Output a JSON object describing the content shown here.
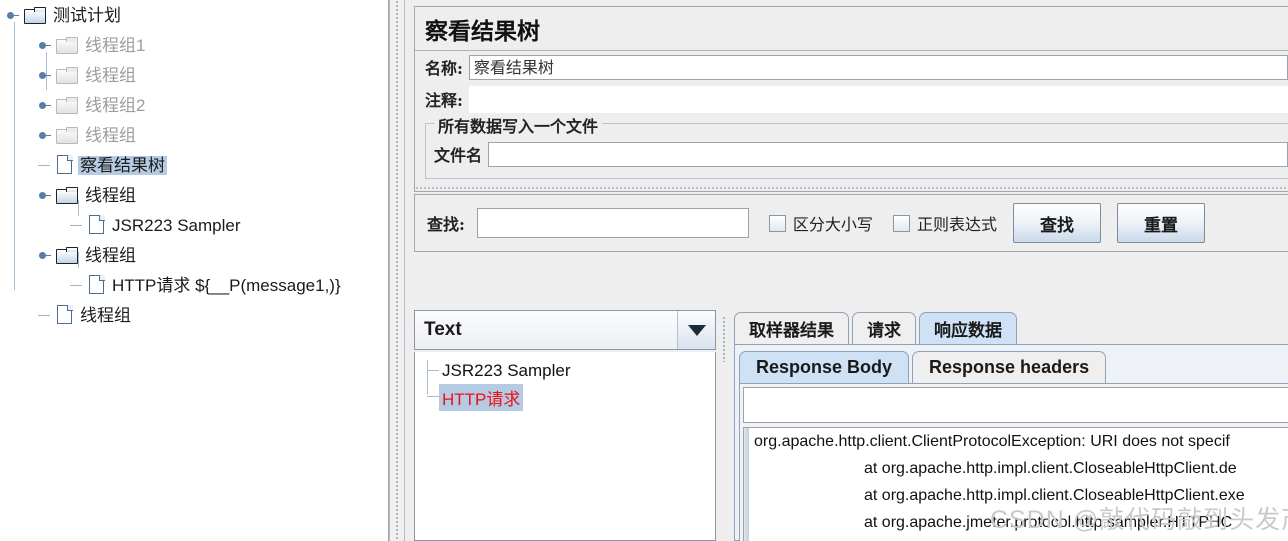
{
  "tree": {
    "items": [
      {
        "label": "测试计划",
        "depth": 0,
        "icon": "folder-icon",
        "handle": "expand-knob",
        "dim": false,
        "selected": false
      },
      {
        "label": "线程组1",
        "depth": 1,
        "icon": "folder-icon",
        "handle": "expand-knob",
        "dim": true,
        "selected": false
      },
      {
        "label": "线程组",
        "depth": 1,
        "icon": "folder-icon",
        "handle": "expand-knob",
        "dim": true,
        "selected": false
      },
      {
        "label": "线程组2",
        "depth": 1,
        "icon": "folder-icon",
        "handle": "expand-knob",
        "dim": true,
        "selected": false
      },
      {
        "label": "线程组",
        "depth": 1,
        "icon": "folder-icon",
        "handle": "expand-knob",
        "dim": true,
        "selected": false
      },
      {
        "label": "察看结果树",
        "depth": 1,
        "icon": "document-icon",
        "handle": "leaf-stub",
        "dim": false,
        "selected": true
      },
      {
        "label": "线程组",
        "depth": 1,
        "icon": "folder-icon",
        "handle": "expand-knob",
        "dim": false,
        "selected": false
      },
      {
        "label": "JSR223 Sampler",
        "depth": 2,
        "icon": "document-icon",
        "handle": "leaf-stub",
        "dim": false,
        "selected": false
      },
      {
        "label": "线程组",
        "depth": 1,
        "icon": "folder-icon",
        "handle": "expand-knob",
        "dim": false,
        "selected": false
      },
      {
        "label": "HTTP请求 ${__P(message1,)}",
        "depth": 2,
        "icon": "document-icon",
        "handle": "leaf-stub",
        "dim": false,
        "selected": false
      },
      {
        "label": "线程组",
        "depth": 1,
        "icon": "document-icon",
        "handle": "leaf-stub",
        "dim": false,
        "selected": false
      }
    ]
  },
  "panel": {
    "title": "察看结果树",
    "name_label": "名称:",
    "name_value": "察看结果树",
    "comment_label": "注释:",
    "comment_value": "",
    "group": {
      "title": "所有数据写入一个文件",
      "filename_label": "文件名",
      "filename_value": ""
    }
  },
  "find_bar": {
    "label": "查找:",
    "query_value": "",
    "case_sensitive_label": "区分大小写",
    "case_sensitive_checked": false,
    "regex_label": "正则表达式",
    "regex_checked": false,
    "find_button": "查找",
    "reset_button": "重置"
  },
  "results": {
    "renderer_value": "Text",
    "items": [
      {
        "label": "JSR223 Sampler",
        "selected": false,
        "error": false
      },
      {
        "label": "HTTP请求",
        "selected": true,
        "error": true
      }
    ]
  },
  "detail_tabs": {
    "items": [
      {
        "label": "取样器结果",
        "active": false
      },
      {
        "label": "请求",
        "active": false
      },
      {
        "label": "响应数据",
        "active": true
      }
    ],
    "sub_items": [
      {
        "label": "Response Body",
        "active": true
      },
      {
        "label": "Response headers",
        "active": false
      }
    ],
    "header_field_value": "",
    "body_lines": [
      {
        "text": "org.apache.http.client.ClientProtocolException: URI does not specif",
        "indent": false
      },
      {
        "text": "at org.apache.http.impl.client.CloseableHttpClient.de",
        "indent": true
      },
      {
        "text": "at org.apache.http.impl.client.CloseableHttpClient.exe",
        "indent": true
      },
      {
        "text": "at org.apache.jmeter.protocol.http.sampler.HTTPHC",
        "indent": true
      }
    ]
  },
  "watermark": {
    "text": "CSDN @敲代码敲到头发茂密"
  },
  "colors": {
    "selection": "#b5cbe3",
    "error_text": "#f01010",
    "active_tab": "#cfe1f5",
    "panel_bg": "#eeeeee",
    "dim_text": "#9d9d9d"
  }
}
